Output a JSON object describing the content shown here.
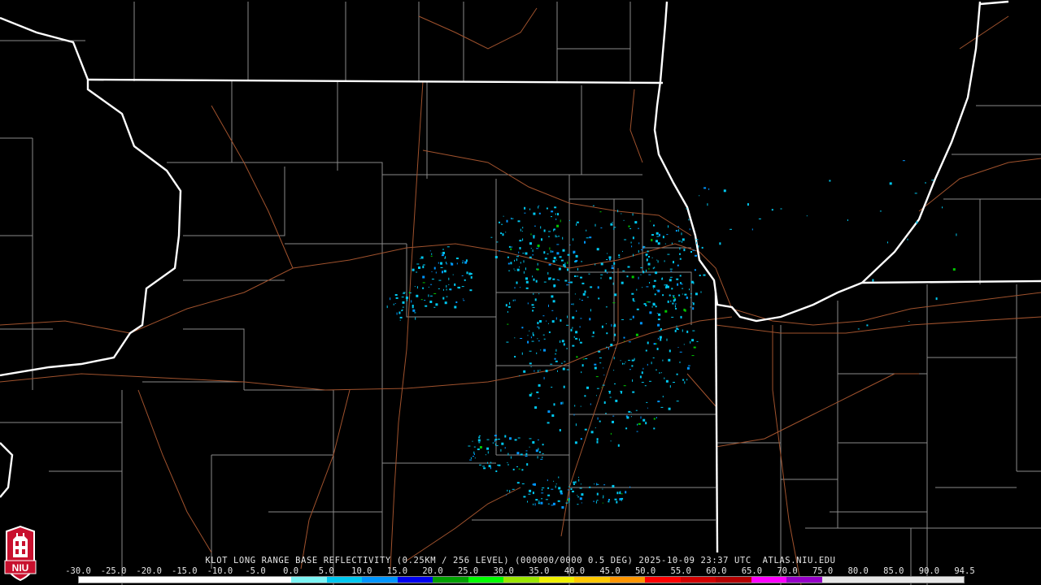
{
  "product_title": "KLOT LONG RANGE BASE REFLECTIVITY (0.25KM / 256 LEVEL) (000000/0000 0.5 DEG) 2025-10-09 23:37 UTC  ATLAS.NIU.EDU",
  "logo_text": "NIU",
  "colorbar": {
    "ticks": [
      "-30.0",
      "-25.0",
      "-20.0",
      "-15.0",
      "-10.0",
      "-5.0",
      "0.0",
      "5.0",
      "10.0",
      "15.0",
      "20.0",
      "25.0",
      "30.0",
      "35.0",
      "40.0",
      "45.0",
      "50.0",
      "55.0",
      "60.0",
      "65.0",
      "70.0",
      "75.0",
      "80.0",
      "85.0",
      "90.0",
      "94.5"
    ],
    "colors": [
      "#ffffff",
      "#ffffff",
      "#ffffff",
      "#ffffff",
      "#ffffff",
      "#ffffff",
      "#7cf4f4",
      "#00c8f0",
      "#0096ff",
      "#0000f0",
      "#00a000",
      "#00ff00",
      "#9ce600",
      "#f0f000",
      "#ffc800",
      "#ff9600",
      "#ff0000",
      "#d20000",
      "#b40000",
      "#ff00ff",
      "#9600c8",
      "#e6e6e6",
      "#e6e6e6",
      "#e6e6e6",
      "#e6e6e6"
    ]
  },
  "colors": {
    "background": "#000000",
    "state_border": "#ffffff",
    "county_line": "#8a8a8a",
    "highway": "#a0522d",
    "echo_light": "#00c8f0",
    "echo_mid": "#0096ff",
    "echo_green": "#00c800"
  }
}
